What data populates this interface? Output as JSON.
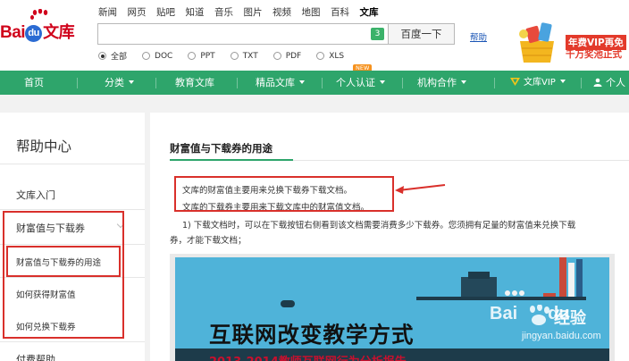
{
  "header": {
    "logo_text": "Bai",
    "logo_du": "du",
    "logo_wenku": "文库",
    "nav_links": [
      "新闻",
      "网页",
      "贴吧",
      "知道",
      "音乐",
      "图片",
      "视频",
      "地图",
      "百科",
      "文库"
    ],
    "search_value": "",
    "search_count": "3",
    "search_button": "百度一下",
    "help_link": "帮助",
    "radios": [
      {
        "label": "全部",
        "selected": true
      },
      {
        "label": "DOC",
        "selected": false
      },
      {
        "label": "PPT",
        "selected": false
      },
      {
        "label": "TXT",
        "selected": false
      },
      {
        "label": "PDF",
        "selected": false
      },
      {
        "label": "XLS",
        "selected": false
      }
    ],
    "promo_line1": "年费VIP再免",
    "promo_line2": "千万奖池正式"
  },
  "mainnav": {
    "items": [
      "首页",
      "分类",
      "教育文库",
      "精品文库",
      "个人认证",
      "机构合作",
      "文库VIP",
      "个人"
    ],
    "new_badge": "NEW",
    "accent": "#2ea56b"
  },
  "sidebar": {
    "title": "帮助中心",
    "item1": "文库入门",
    "item2": "财富值与下载券",
    "sub1": "财富值与下载券的用途",
    "sub2": "如何获得财富值",
    "sub3": "如何兑换下载券",
    "item3": "付费帮助"
  },
  "content": {
    "title": "财富值与下载券的用途",
    "line1": "文库的财富值主要用来兑换下载券下载文档。",
    "line2": "文库的下载券主要用来下载文库中的财富值文档。",
    "line3": "1) 下载文档时，可以在下载按钮右侧看到该文档需要消费多少下载券。您须拥有足量的财富值来兑换下载",
    "line4": "券，才能下载文档；",
    "banner_headline": "互联网改变教学方式",
    "banner_sub": "2013-2014教师互联网行为分析报告"
  },
  "watermark": {
    "text": "Bai",
    "text_du": "du",
    "cn": "经验",
    "url": "jingyan.baidu.com"
  },
  "colors": {
    "annotation_red": "#d9302b",
    "nav_green": "#2ea56b",
    "banner_blue": "#4fb3d9"
  }
}
